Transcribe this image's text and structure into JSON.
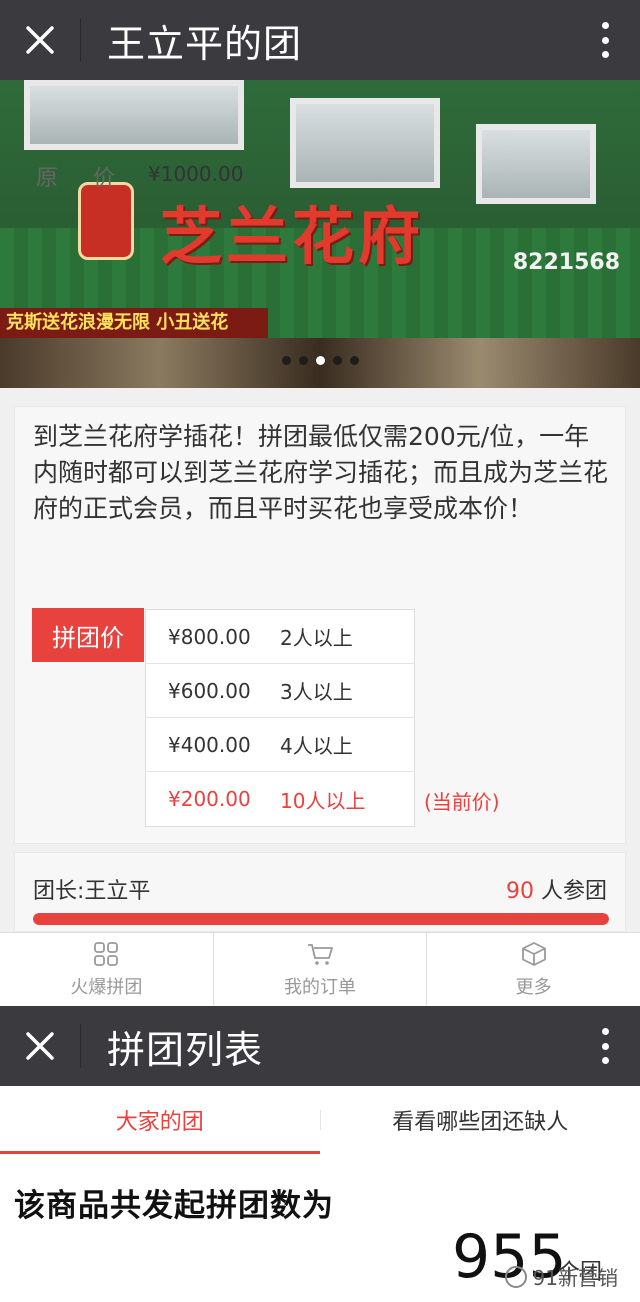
{
  "header": {
    "title": "王立平的团"
  },
  "banner": {
    "store_name": "芝兰花府",
    "phone": "8221568",
    "strip_text": "克斯送花浪漫无限  小丑送花",
    "slide_count": 5,
    "active_slide": 2
  },
  "product": {
    "description": "到芝兰花府学插花！拼团最低仅需200元/位，一年内随时都可以到芝兰花府学习插花；而且成为芝兰花府的正式会员，而且平时买花也享受成本价！",
    "original_price_label": "原 价",
    "original_price": "¥1000.00",
    "group_price_label": "拼团价",
    "tiers": [
      {
        "price": "¥800.00",
        "people": "2人以上"
      },
      {
        "price": "¥600.00",
        "people": "3人以上"
      },
      {
        "price": "¥400.00",
        "people": "4人以上"
      },
      {
        "price": "¥200.00",
        "people": "10人以上"
      }
    ],
    "current_label": "(当前价)"
  },
  "leader": {
    "name": "团长:王立平",
    "count": "90",
    "count_suffix": " 人参团",
    "progress": 1.0
  },
  "tabbar": {
    "items": [
      {
        "label": "火爆拼团",
        "icon": "grid-icon"
      },
      {
        "label": "我的订单",
        "icon": "cart-icon"
      },
      {
        "label": "更多",
        "icon": "cube-icon"
      }
    ]
  },
  "header2": {
    "title": "拼团列表"
  },
  "segments": {
    "items": [
      "大家的团",
      "看看哪些团还缺人"
    ],
    "active": 0
  },
  "total": {
    "label": "该商品共发起拼团数为",
    "value": "955",
    "unit": "个团"
  },
  "watermark": {
    "text": "91新营销"
  },
  "colors": {
    "accent": "#e8423f",
    "topbar": "#3b3b3f"
  }
}
